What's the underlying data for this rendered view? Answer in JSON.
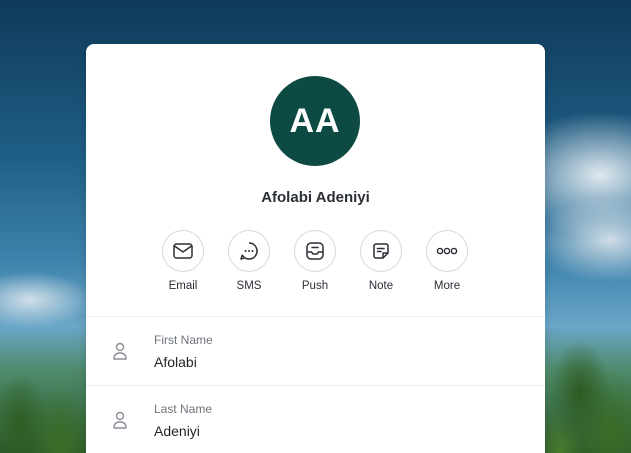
{
  "contact": {
    "initials": "AA",
    "full_name": "Afolabi Adeniyi",
    "avatar_color": "#0d4a43"
  },
  "actions": [
    {
      "label": "Email",
      "icon": "mail-icon"
    },
    {
      "label": "SMS",
      "icon": "chat-bubble-icon"
    },
    {
      "label": "Push",
      "icon": "inbox-icon"
    },
    {
      "label": "Note",
      "icon": "note-icon"
    },
    {
      "label": "More",
      "icon": "more-dots-icon"
    }
  ],
  "fields": [
    {
      "label": "First Name",
      "value": "Afolabi",
      "icon": "person-icon"
    },
    {
      "label": "Last Name",
      "value": "Adeniyi",
      "icon": "person-icon"
    }
  ]
}
